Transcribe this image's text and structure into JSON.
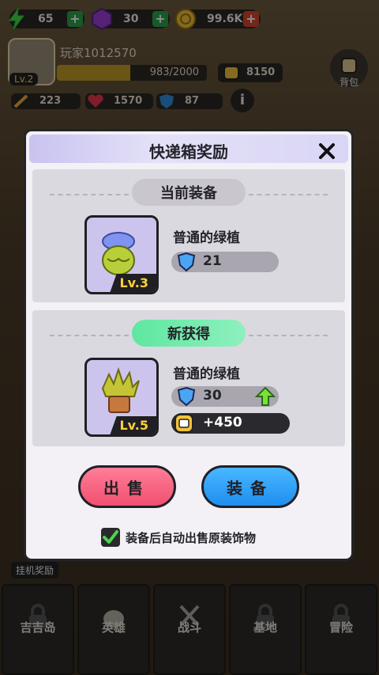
{
  "colors": {
    "accent_green": "#5ee7a0",
    "sell_button": "#f0506f",
    "equip_button": "#1e8ef0"
  },
  "resources": [
    {
      "icon": "energy-icon",
      "value": "65"
    },
    {
      "icon": "gem-icon",
      "value": "30"
    },
    {
      "icon": "coin-icon",
      "value": "99.6K"
    }
  ],
  "player": {
    "name": "玩家1012570",
    "level": "Lv.2",
    "xp_text": "983/2000",
    "xp_fraction": 0.49,
    "power": "8150",
    "attack": "223",
    "hp": "1570",
    "defense": "87"
  },
  "bag_label": "背包",
  "afk_label": "挂机奖励",
  "nav": [
    {
      "label": "吉吉岛",
      "locked": true
    },
    {
      "label": "英雄",
      "locked": false
    },
    {
      "label": "战斗",
      "locked": false
    },
    {
      "label": "基地",
      "locked": true
    },
    {
      "label": "冒险",
      "locked": true
    }
  ],
  "modal": {
    "title": "快递箱奖励",
    "current": {
      "chip": "当前装备",
      "name": "普通的绿植",
      "level": "Lv.3",
      "defense": "21"
    },
    "new": {
      "chip": "新获得",
      "name": "普通的绿植",
      "level": "Lv.5",
      "defense": "30",
      "power": "+450"
    },
    "sell_label": "出售",
    "equip_label": "装备",
    "auto_sell_label": "装备后自动出售原装饰物",
    "auto_sell_checked": true
  }
}
